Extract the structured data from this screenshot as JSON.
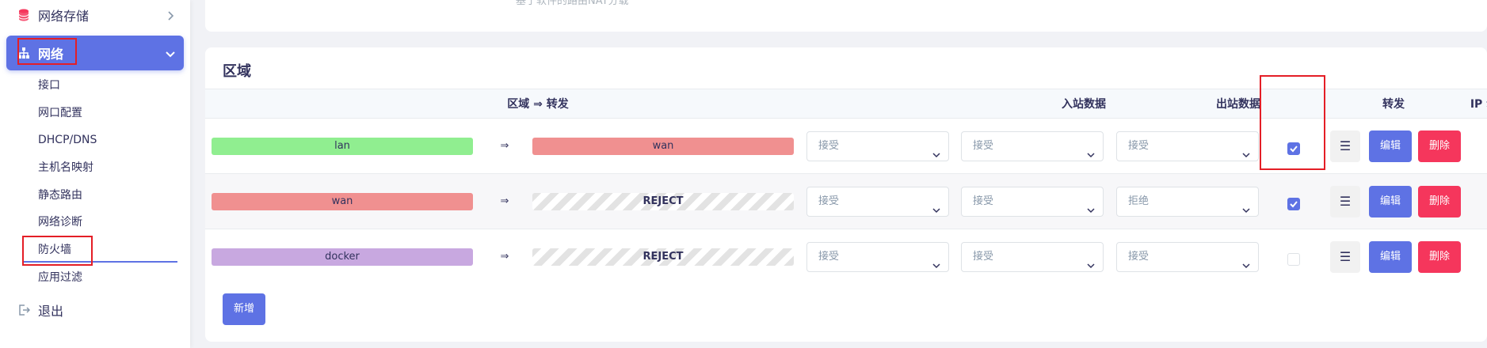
{
  "sidebar": {
    "storage_label": "网络存储",
    "network_label": "网络",
    "sub_items": [
      "接口",
      "网口配置",
      "DHCP/DNS",
      "主机名映射",
      "静态路由",
      "网络诊断",
      "防火墙",
      "应用过滤"
    ],
    "logout_label": "退出"
  },
  "top_card": {
    "faded_text": "基于软件的路由NAT分载"
  },
  "zones": {
    "title": "区域",
    "headers": {
      "zone_forward": "区域 ⇒ 转发",
      "input": "入站数据",
      "output": "出站数据",
      "forward": "转发",
      "masq": "IP 动态伪装"
    },
    "arrow_glyph": "⇒",
    "rows": [
      {
        "zone": "lan",
        "zone_color": "#90ee90",
        "target": "wan",
        "target_color": "#f09090",
        "input": "接受",
        "output": "接受",
        "forward": "接受",
        "masq": true
      },
      {
        "zone": "wan",
        "zone_color": "#f09090",
        "target": "REJECT",
        "input": "接受",
        "output": "接受",
        "forward": "拒绝",
        "masq": true
      },
      {
        "zone": "docker",
        "zone_color": "#c8a8e0",
        "target": "REJECT",
        "input": "接受",
        "output": "接受",
        "forward": "接受",
        "masq": false
      }
    ],
    "buttons": {
      "menu": "☰",
      "edit": "编辑",
      "delete": "删除",
      "add": "新增"
    }
  },
  "colors": {
    "accent": "#5e72e4",
    "danger": "#f5365c",
    "highlight": "#e41e26"
  }
}
